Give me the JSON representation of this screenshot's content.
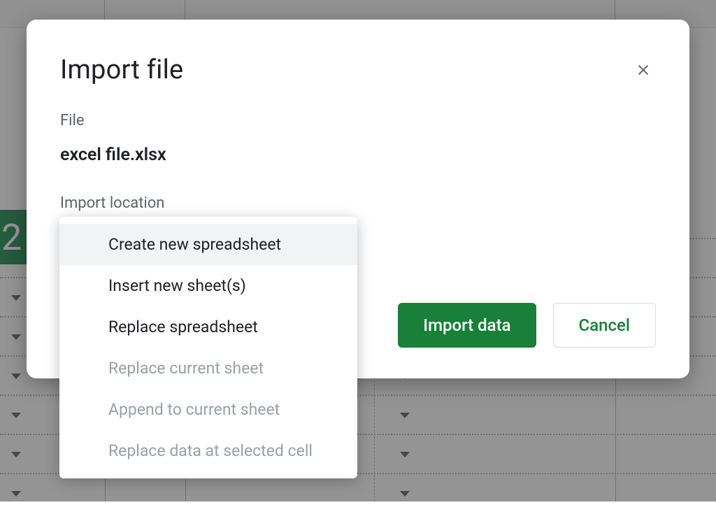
{
  "background": {
    "green_cell_text": "2"
  },
  "dialog": {
    "title": "Import file",
    "file_section_label": "File",
    "file_name": "excel file.xlsx",
    "location_section_label": "Import location",
    "import_button": "Import data",
    "cancel_button": "Cancel"
  },
  "dropdown": {
    "items": [
      {
        "label": "Create new spreadsheet",
        "disabled": false,
        "highlighted": true
      },
      {
        "label": "Insert new sheet(s)",
        "disabled": false,
        "highlighted": false
      },
      {
        "label": "Replace spreadsheet",
        "disabled": false,
        "highlighted": false
      },
      {
        "label": "Replace current sheet",
        "disabled": true,
        "highlighted": false
      },
      {
        "label": "Append to current sheet",
        "disabled": true,
        "highlighted": false
      },
      {
        "label": "Replace data at selected cell",
        "disabled": true,
        "highlighted": false
      }
    ]
  }
}
